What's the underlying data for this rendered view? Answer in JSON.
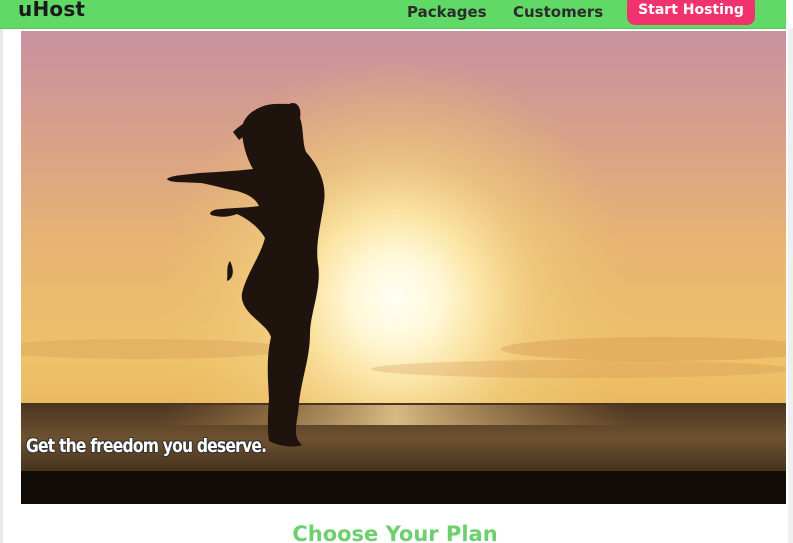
{
  "header": {
    "brand": "uHost",
    "nav": {
      "packages": "Packages",
      "customers": "Customers"
    },
    "cta_label": "Start Hosting"
  },
  "hero": {
    "tagline": "Get the freedom you deserve.",
    "image_subject": "woman-silhouette-at-sunset"
  },
  "plans": {
    "heading": "Choose Your Plan"
  },
  "colors": {
    "nav_background": "#61d966",
    "cta_background": "#f0336f",
    "heading_green": "#6ecf6f"
  }
}
